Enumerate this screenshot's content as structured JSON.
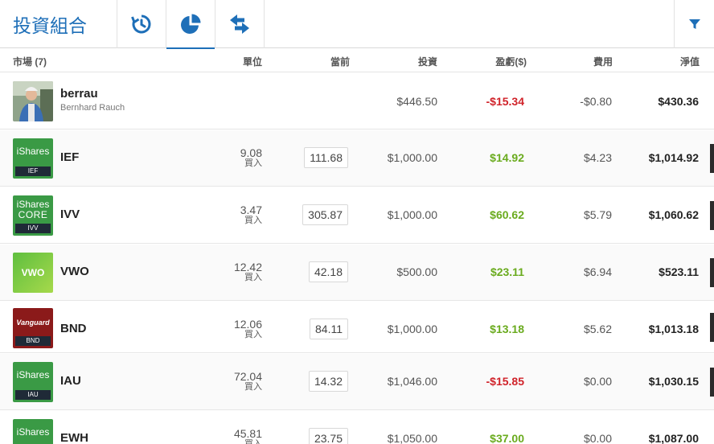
{
  "header": {
    "title": "投資組合",
    "tabs": [
      {
        "icon": "history-icon"
      },
      {
        "icon": "pie-chart-icon"
      },
      {
        "icon": "swap-arrows-icon"
      }
    ],
    "active_tab": 1,
    "filter_icon": "filter-icon",
    "accent_color": "#1e6fb8"
  },
  "columns": {
    "market": "市場 (7)",
    "units": "單位",
    "current": "當前",
    "invested": "投資",
    "pl": "盈虧($)",
    "fees": "費用",
    "value": "淨值"
  },
  "user_row": {
    "username": "berrau",
    "fullname": "Bernhard Rauch",
    "invested": "$446.50",
    "pl": "-$15.34",
    "fees": "-$0.80",
    "value": "$430.36"
  },
  "rows": [
    {
      "logo": "ishares",
      "brand": "iShares",
      "brand2": "",
      "tag": "IEF",
      "ticker": "IEF",
      "units": "9.08",
      "action": "買入",
      "current": "111.68",
      "invested": "$1,000.00",
      "pl": "$14.92",
      "pl_sign": "pos",
      "fees": "$4.23",
      "value": "$1,014.92"
    },
    {
      "logo": "ishares",
      "brand": "iShares",
      "brand2": "CORE",
      "tag": "IVV",
      "ticker": "IVV",
      "units": "3.47",
      "action": "買入",
      "current": "305.87",
      "invested": "$1,000.00",
      "pl": "$60.62",
      "pl_sign": "pos",
      "fees": "$5.79",
      "value": "$1,060.62"
    },
    {
      "logo": "vwo",
      "brand": "VWO",
      "brand2": "",
      "tag": "",
      "ticker": "VWO",
      "units": "12.42",
      "action": "買入",
      "current": "42.18",
      "invested": "$500.00",
      "pl": "$23.11",
      "pl_sign": "pos",
      "fees": "$6.94",
      "value": "$523.11"
    },
    {
      "logo": "vanguard",
      "brand": "Vanguard",
      "brand2": "",
      "tag": "BND",
      "ticker": "BND",
      "units": "12.06",
      "action": "買入",
      "current": "84.11",
      "invested": "$1,000.00",
      "pl": "$13.18",
      "pl_sign": "pos",
      "fees": "$5.62",
      "value": "$1,013.18"
    },
    {
      "logo": "ishares",
      "brand": "iShares",
      "brand2": "",
      "tag": "IAU",
      "ticker": "IAU",
      "units": "72.04",
      "action": "買入",
      "current": "14.32",
      "invested": "$1,046.00",
      "pl": "-$15.85",
      "pl_sign": "neg",
      "fees": "$0.00",
      "value": "$1,030.15"
    },
    {
      "logo": "ishares",
      "brand": "iShares",
      "brand2": "",
      "tag": "EWH",
      "ticker": "EWH",
      "units": "45.81",
      "action": "買入",
      "current": "23.75",
      "invested": "$1,050.00",
      "pl": "$37.00",
      "pl_sign": "pos",
      "fees": "$0.00",
      "value": "$1,087.00"
    }
  ],
  "colors": {
    "positive": "#6aab1e",
    "negative": "#d0232a"
  }
}
